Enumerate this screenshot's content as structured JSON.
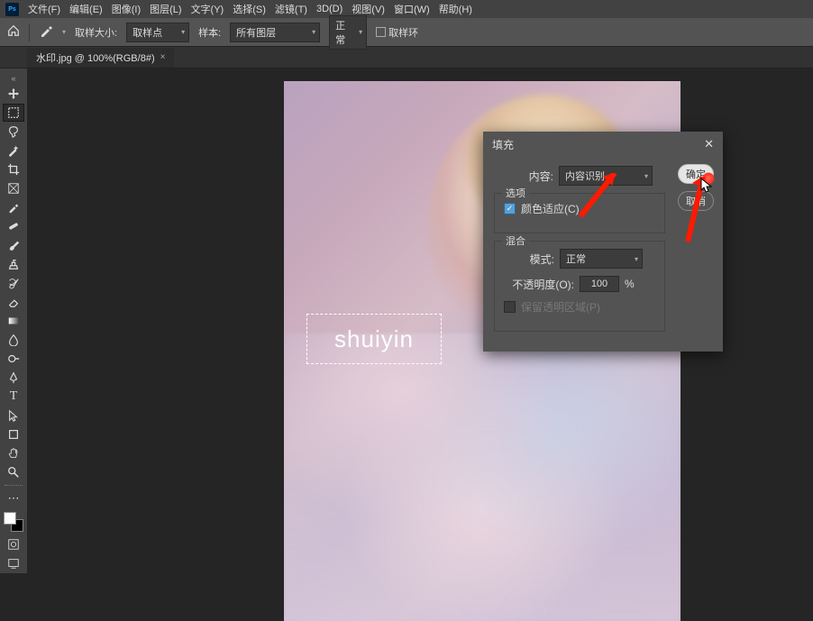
{
  "menubar": {
    "items": [
      "文件(F)",
      "编辑(E)",
      "图像(I)",
      "图层(L)",
      "文字(Y)",
      "选择(S)",
      "滤镜(T)",
      "3D(D)",
      "视图(V)",
      "窗口(W)",
      "帮助(H)"
    ]
  },
  "optbar": {
    "sample_size_label": "取样大小:",
    "sample_size_value": "取样点",
    "sample_label": "样本:",
    "sample_value": "所有图层",
    "mode_value": "正常",
    "ring": "取样环"
  },
  "tab": {
    "title": "水印.jpg @ 100%(RGB/8#)",
    "close": "×"
  },
  "watermark": "shuiyin",
  "dialog": {
    "title": "填充",
    "content_label": "内容:",
    "content_value": "内容识别",
    "options_title": "选项",
    "checkbox_label": "颜色适应(C)",
    "blend_title": "混合",
    "mode_label": "模式:",
    "mode_value": "正常",
    "opacity_label": "不透明度(O):",
    "opacity_value": "100",
    "opacity_unit": "%",
    "preserve_label": "保留透明区域(P)",
    "ok": "确定",
    "cancel": "取消"
  },
  "colors": {
    "accent": "#ff1a00"
  }
}
